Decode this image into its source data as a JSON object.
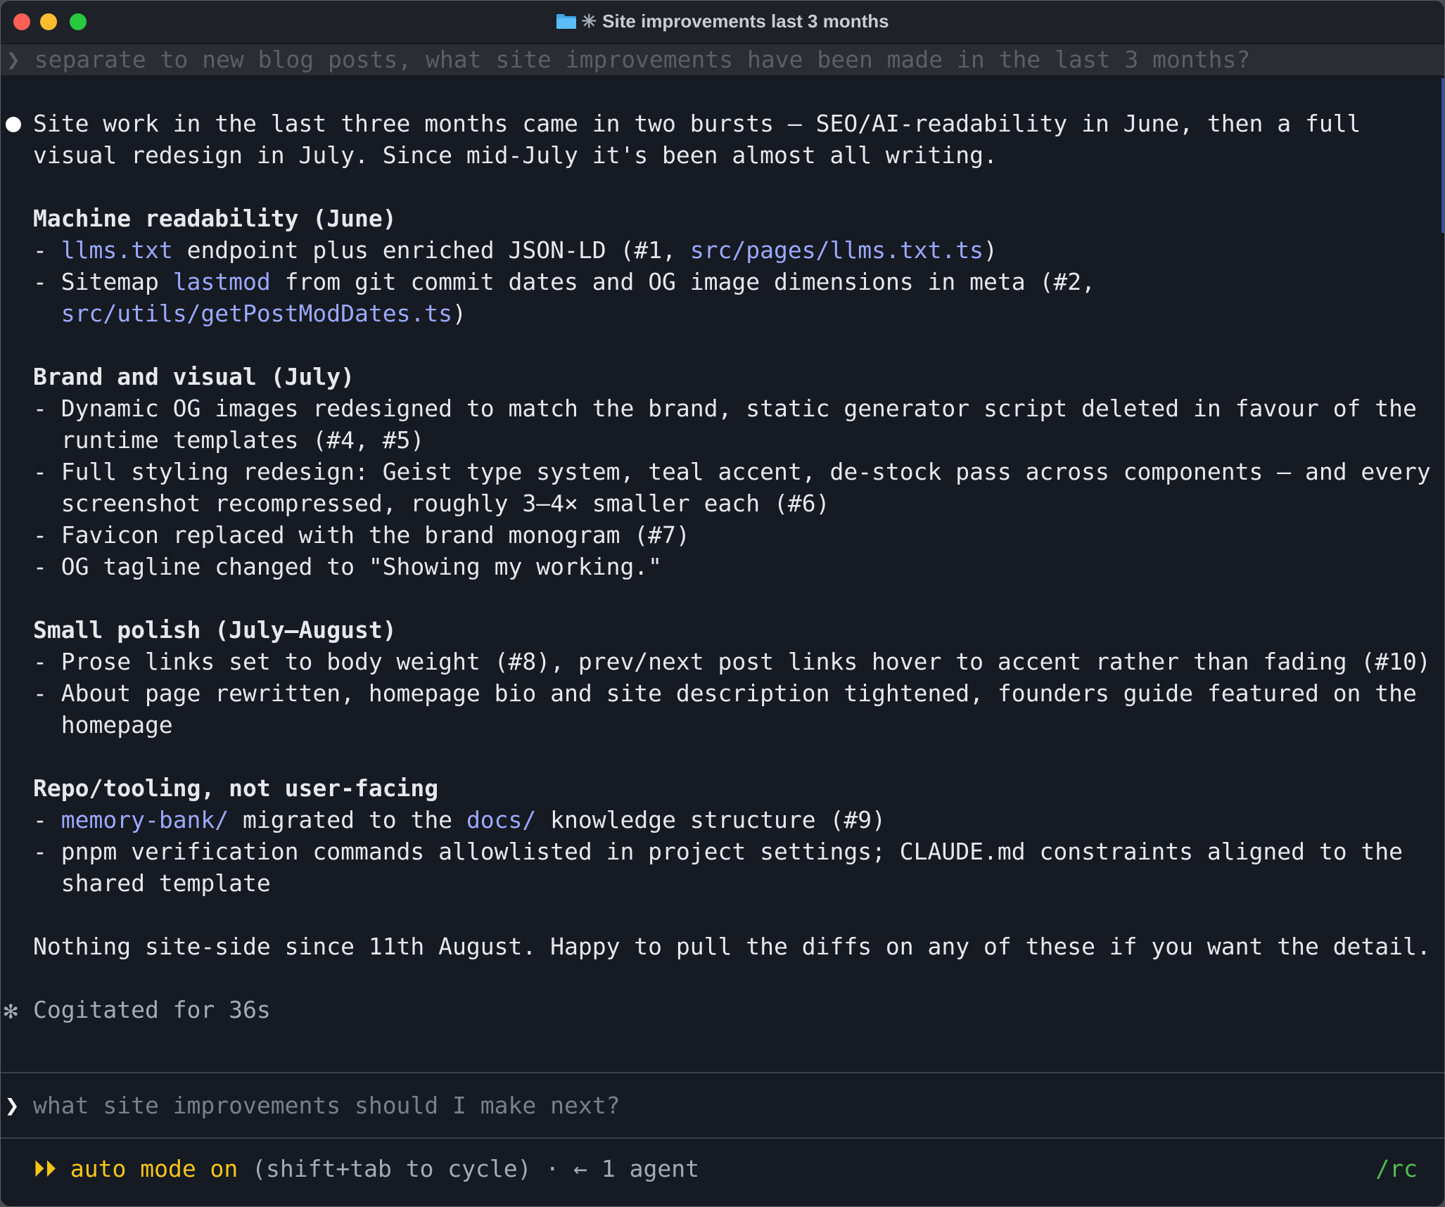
{
  "window": {
    "title": "Site improvements last 3 months",
    "title_prefix_icon": "folder-icon",
    "title_spark": "✳"
  },
  "previous_prompt": {
    "chevron": "❯",
    "text": "separate to new blog posts, what site improvements have been made in the last 3 months?"
  },
  "response": {
    "intro": [
      "Site work in the last three months came in two bursts – SEO/AI-readability in June, then a full",
      "visual redesign in July. Since mid-July it's been almost all writing."
    ],
    "sections": [
      {
        "heading": "Machine readability (June)",
        "lines": [
          {
            "segments": [
              {
                "t": "- "
              },
              {
                "t": "llms.txt",
                "link": true
              },
              {
                "t": " endpoint plus enriched JSON-LD (#1, "
              },
              {
                "t": "src/pages/llms.txt.ts",
                "link": true
              },
              {
                "t": ")"
              }
            ]
          },
          {
            "segments": [
              {
                "t": "- Sitemap "
              },
              {
                "t": "lastmod",
                "link": true
              },
              {
                "t": " from git commit dates and OG image dimensions in meta (#2,"
              }
            ]
          },
          {
            "segments": [
              {
                "t": "  "
              },
              {
                "t": "src/utils/getPostModDates.ts",
                "link": true
              },
              {
                "t": ")"
              }
            ]
          }
        ]
      },
      {
        "heading": "Brand and visual (July)",
        "lines": [
          {
            "segments": [
              {
                "t": "- Dynamic OG images redesigned to match the brand, static generator script deleted in favour of the"
              }
            ]
          },
          {
            "segments": [
              {
                "t": "  runtime templates (#4, #5)"
              }
            ]
          },
          {
            "segments": [
              {
                "t": "- Full styling redesign: Geist type system, teal accent, de-stock pass across components – and every"
              }
            ]
          },
          {
            "segments": [
              {
                "t": "  screenshot recompressed, roughly 3–4× smaller each (#6)"
              }
            ]
          },
          {
            "segments": [
              {
                "t": "- Favicon replaced with the brand monogram (#7)"
              }
            ]
          },
          {
            "segments": [
              {
                "t": "- OG tagline changed to \"Showing my working.\""
              }
            ]
          }
        ]
      },
      {
        "heading": "Small polish (July–August)",
        "lines": [
          {
            "segments": [
              {
                "t": "- Prose links set to body weight (#8), prev/next post links hover to accent rather than fading (#10)"
              }
            ]
          },
          {
            "segments": [
              {
                "t": "- About page rewritten, homepage bio and site description tightened, founders guide featured on the"
              }
            ]
          },
          {
            "segments": [
              {
                "t": "  homepage"
              }
            ]
          }
        ]
      },
      {
        "heading": "Repo/tooling, not user-facing",
        "lines": [
          {
            "segments": [
              {
                "t": "- "
              },
              {
                "t": "memory-bank/",
                "link": true
              },
              {
                "t": " migrated to the "
              },
              {
                "t": "docs/",
                "link": true
              },
              {
                "t": " knowledge structure (#9)"
              }
            ]
          },
          {
            "segments": [
              {
                "t": "- pnpm verification commands allowlisted in project settings; CLAUDE.md constraints aligned to the"
              }
            ]
          },
          {
            "segments": [
              {
                "t": "  shared template"
              }
            ]
          }
        ]
      }
    ],
    "closing": "Nothing site-side since 11th August. Happy to pull the diffs on any of these if you want the detail."
  },
  "thinking": {
    "icon": "✻",
    "text": "Cogitated for 36s"
  },
  "input": {
    "chevron": "❯",
    "value": "",
    "placeholder": "what site improvements should I make next?"
  },
  "status_bar": {
    "mode_icon": "⏵⏵",
    "mode_label": "auto mode on",
    "hint": " (shift+tab to cycle)",
    "separator": " · ",
    "agents": "← 1 agent",
    "rc": "/rc"
  },
  "colors": {
    "background": "#161a22",
    "link": "#9ba9ff",
    "accent_yellow": "#f5c518",
    "rc_green": "#4fbf4f"
  }
}
